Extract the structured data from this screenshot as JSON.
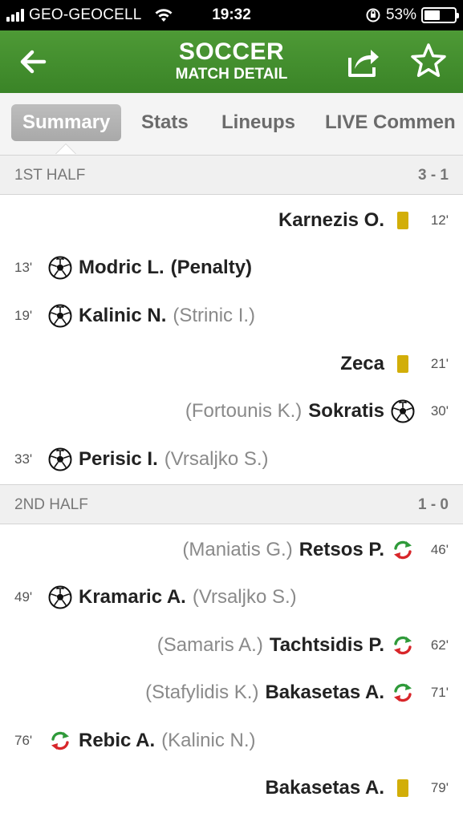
{
  "status_bar": {
    "carrier": "GEO-GEOCELL",
    "time": "19:32",
    "battery": "53%",
    "battery_level": 0.53
  },
  "header": {
    "title": "SOCCER",
    "subtitle": "MATCH DETAIL",
    "icons": [
      "back-arrow-icon",
      "share-icon",
      "star-icon"
    ]
  },
  "tabs": {
    "summary": "Summary",
    "stats": "Stats",
    "lineups": "Lineups",
    "live": "LIVE Commen"
  },
  "first_half": {
    "label": "1ST HALF",
    "score": "3 - 1",
    "events": [
      {
        "minute": "12'",
        "player": "Karnezis O.",
        "type": "yellow-card",
        "side": "right"
      },
      {
        "minute": "13'",
        "player": "Modric L.",
        "detail": "(Penalty)",
        "type": "goal",
        "side": "left"
      },
      {
        "minute": "19'",
        "player": "Kalinic N.",
        "assist": "(Strinic I.)",
        "type": "goal",
        "side": "left"
      },
      {
        "minute": "21'",
        "player": "Zeca",
        "type": "yellow-card",
        "side": "right"
      },
      {
        "minute": "30'",
        "player": "Sokratis",
        "assist": "(Fortounis K.)",
        "type": "goal",
        "side": "right"
      },
      {
        "minute": "33'",
        "player": "Perisic I.",
        "assist": "(Vrsaljko S.)",
        "type": "goal",
        "side": "left"
      }
    ]
  },
  "second_half": {
    "label": "2ND HALF",
    "score": "1 - 0",
    "events": [
      {
        "minute": "46'",
        "player": "Retsos P.",
        "assist": "(Maniatis G.)",
        "type": "substitution",
        "side": "right"
      },
      {
        "minute": "49'",
        "player": "Kramaric A.",
        "assist": "(Vrsaljko S.)",
        "type": "goal",
        "side": "left"
      },
      {
        "minute": "62'",
        "player": "Tachtsidis P.",
        "assist": "(Samaris A.)",
        "type": "substitution",
        "side": "right"
      },
      {
        "minute": "71'",
        "player": "Bakasetas A.",
        "assist": "(Stafylidis K.)",
        "type": "substitution",
        "side": "right"
      },
      {
        "minute": "76'",
        "player": "Rebic A.",
        "assist": "(Kalinic N.)",
        "type": "substitution",
        "side": "left"
      },
      {
        "minute": "79'",
        "player": "Bakasetas A.",
        "type": "yellow-card",
        "side": "right"
      }
    ]
  },
  "colors": {
    "header_green": "#3f8a2c",
    "yellow_card": "#d2ae08",
    "sub_green": "#2f9a3a",
    "sub_red": "#d8262a"
  }
}
